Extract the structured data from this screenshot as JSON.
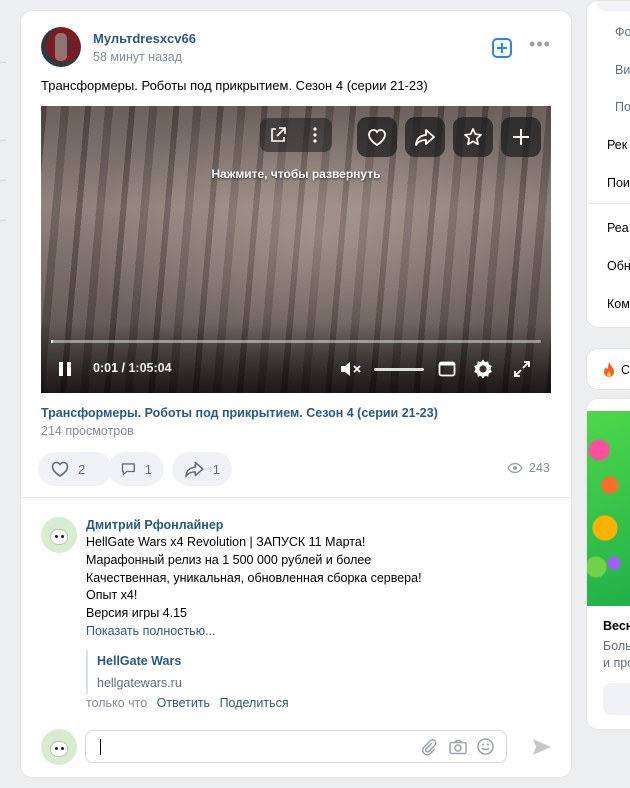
{
  "post": {
    "author": "Мультdresxcv66",
    "time": "58 минут назад",
    "text": "Трансформеры. Роботы под прикрытием. Сезон 4 (серии 21-23)",
    "video": {
      "overlay": "Нажмите, чтобы развернуть",
      "current_time": "0:01",
      "separator": " / ",
      "duration": "1:05:04",
      "progress": 0.003,
      "volume_muted": true
    },
    "video_title": "Трансформеры. Роботы под прикрытием. Сезон 4 (серии 21-23)",
    "video_views": "214 просмотров",
    "likes": "2",
    "comments": "1",
    "shares": "1",
    "views": "243"
  },
  "comment": {
    "author": "Дмитрий Рфонлайнер",
    "lines": [
      "HellGate Wars x4 Revolution | ЗАПУСК 11 Марта!",
      "Марафонный релиз на 1 500 000 рублей и более",
      "Качественная, уникальная, обновленная сборка сервера!",
      "Опыт x4!",
      "Версия игры 4.15"
    ],
    "show_more": "Показать полностью...",
    "link_title": "HellGate Wars",
    "link_url": "hellgatewars.ru",
    "time": "только что",
    "reply": "Ответить",
    "share": "Поделиться"
  },
  "sidebar": {
    "items": [
      "Фо",
      "Ви",
      "По",
      "Рек",
      "Пои",
      "Реа",
      "Обн",
      "Ком"
    ],
    "card2_label": "С",
    "promo_title": "Весн",
    "promo_line1": "Боль",
    "promo_line2": "и про"
  },
  "colors": {
    "link": "#2a5885",
    "accent": "#2688eb",
    "muted": "#818c99",
    "background": "#edeef0"
  }
}
